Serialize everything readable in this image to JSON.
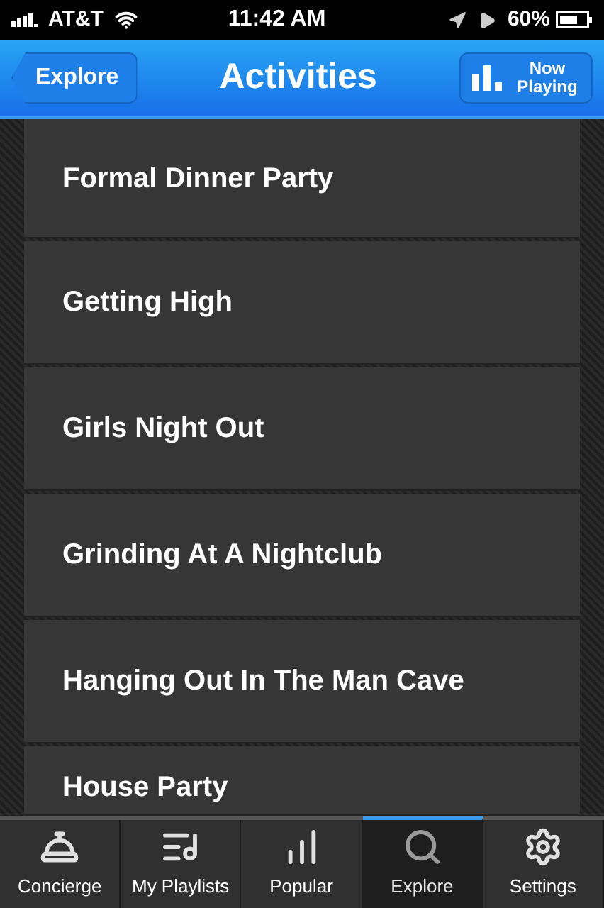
{
  "status_bar": {
    "carrier": "AT&T",
    "time": "11:42 AM",
    "battery": "60%"
  },
  "nav_bar": {
    "back_button": "Explore",
    "title": "Activities",
    "now_playing_button": "Now Playing"
  },
  "items": [
    {
      "label": "Formal Dinner Party"
    },
    {
      "label": "Getting High"
    },
    {
      "label": "Girls Night Out"
    },
    {
      "label": "Grinding At A Nightclub"
    },
    {
      "label": "Hanging Out In The Man Cave"
    },
    {
      "label": "House Party"
    }
  ],
  "tab_bar": [
    {
      "label": "Concierge",
      "kind": "concierge",
      "selected": false
    },
    {
      "label": "My Playlists",
      "kind": "playlists",
      "selected": false
    },
    {
      "label": "Popular",
      "kind": "popular",
      "selected": false
    },
    {
      "label": "Explore",
      "kind": "explore",
      "selected": true
    },
    {
      "label": "Settings",
      "kind": "settings",
      "selected": false
    }
  ]
}
